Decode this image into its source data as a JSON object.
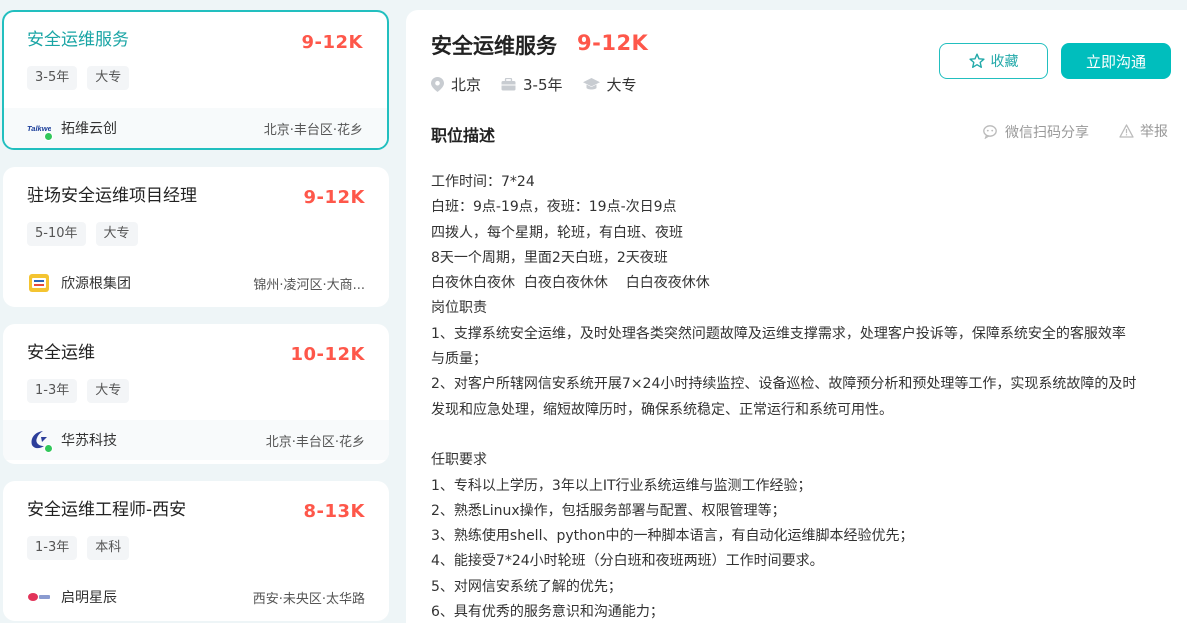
{
  "job_list": [
    {
      "title": "安全运维服务",
      "salary": "9-12K",
      "tags": [
        "3-5年",
        "大专"
      ],
      "company": "拓维云创",
      "logo_text": "Talkweb",
      "location": "北京·丰台区·花乡",
      "online": true,
      "active": true
    },
    {
      "title": "驻场安全运维项目经理",
      "salary": "9-12K",
      "tags": [
        "5-10年",
        "大专"
      ],
      "company": "欣源根集团",
      "location": "锦州·凌河区·大商...",
      "online": false,
      "active": false
    },
    {
      "title": "安全运维",
      "salary": "10-12K",
      "tags": [
        "1-3年",
        "大专"
      ],
      "company": "华苏科技",
      "location": "北京·丰台区·花乡",
      "online": true,
      "active": false
    },
    {
      "title": "安全运维工程师-西安",
      "salary": "8-13K",
      "tags": [
        "1-3年",
        "本科"
      ],
      "company": "启明星辰",
      "location": "西安·未央区·太华路",
      "online": false,
      "active": false
    }
  ],
  "detail": {
    "title": "安全运维服务",
    "salary": "9-12K",
    "city": "北京",
    "experience": "3-5年",
    "degree": "大专",
    "collect_label": "收藏",
    "chat_label": "立即沟通",
    "section_title": "职位描述",
    "share_label": "微信扫码分享",
    "report_label": "举报",
    "description_lines": [
      "工作时间：7*24",
      "白班：9点-19点，夜班：19点-次日9点",
      "四拨人，每个星期，轮班，有白班、夜班",
      "8天一个周期，里面2天白班，2天夜班",
      "白夜休白夜休  白夜白夜休休    白白夜夜休休",
      "岗位职责",
      "1、支撑系统安全运维，及时处理各类突然问题故障及运维支撑需求，处理客户投诉等，保障系统安全的客服效率",
      "与质量；",
      "2、对客户所辖网信安系统开展7×24小时持续监控、设备巡检、故障预分析和预处理等工作，实现系统故障的及时",
      "发现和应急处理，缩短故障历时，确保系统稳定、正常运行和系统可用性。",
      "",
      "任职要求",
      "1、专科以上学历，3年以上IT行业系统运维与监测工作经验；",
      "2、熟悉Linux操作，包括服务部署与配置、权限管理等；",
      "3、熟练使用shell、python中的一种脚本语言，有自动化运维脚本经验优先；",
      "4、能接受7*24小时轮班（分白班和夜班两班）工作时间要求。",
      "5、对网信安系统了解的优先；",
      "6、具有优秀的服务意识和沟通能力；"
    ]
  },
  "colors": {
    "accent": "#00bebd",
    "salary": "#fe574a",
    "online": "#32c75b"
  }
}
